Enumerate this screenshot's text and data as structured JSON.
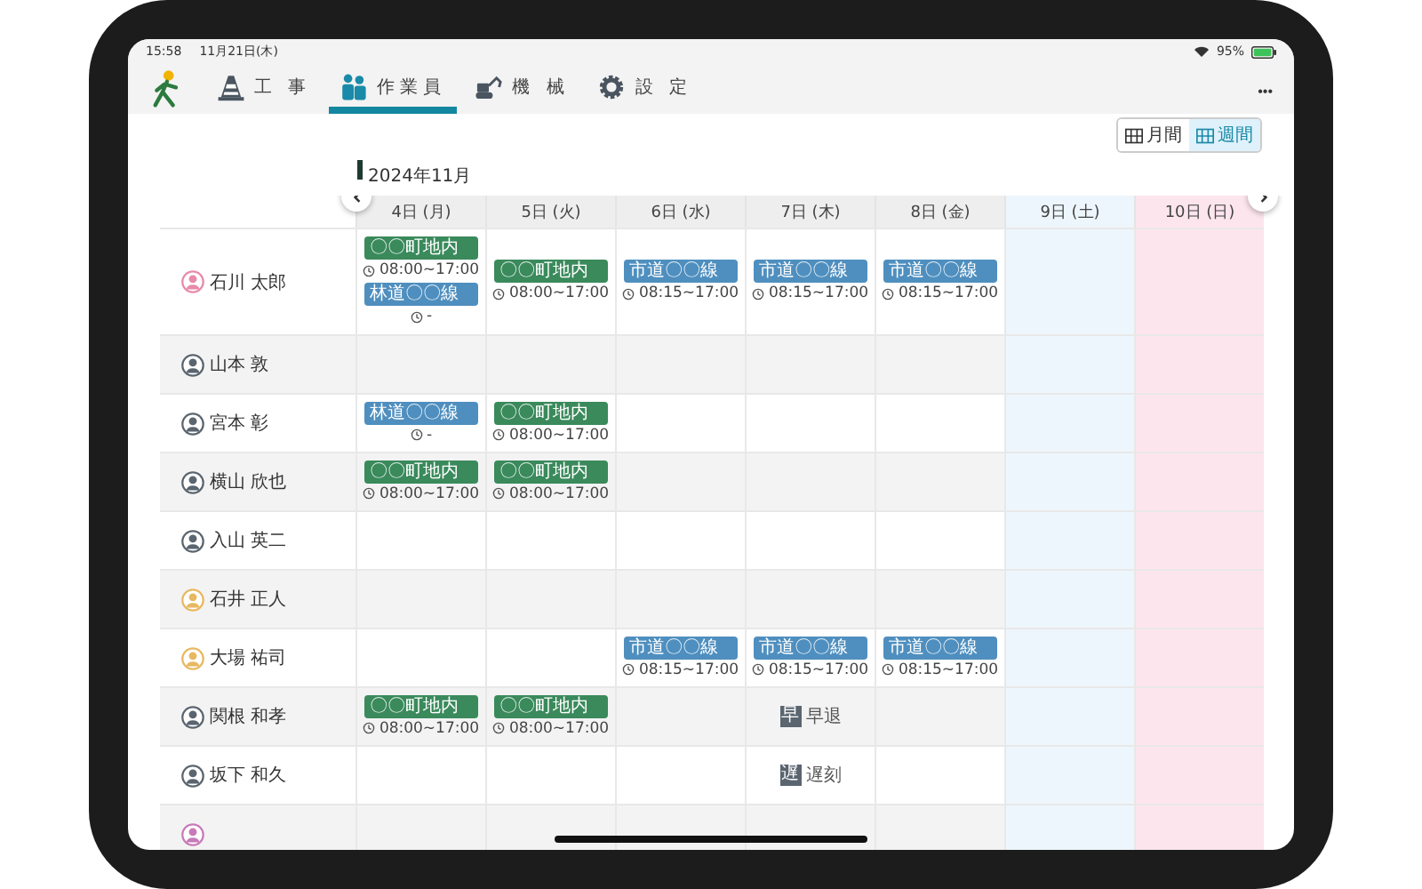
{
  "status_bar": {
    "time": "15:58",
    "date": "11月21日(木)",
    "battery": "95%"
  },
  "nav": {
    "tabs": [
      {
        "label": "工 事",
        "selected": false
      },
      {
        "label": "作業員",
        "selected": true
      },
      {
        "label": "機 械",
        "selected": false
      },
      {
        "label": "設 定",
        "selected": false
      }
    ],
    "menu": "•••"
  },
  "view_toggle": [
    {
      "label": "月間",
      "selected": false
    },
    {
      "label": "週間",
      "selected": true
    }
  ],
  "month": "2024年11月",
  "columns": [
    {
      "label": "4日 (月)",
      "kind": "weekday"
    },
    {
      "label": "5日 (火)",
      "kind": "weekday"
    },
    {
      "label": "6日 (水)",
      "kind": "weekday"
    },
    {
      "label": "7日 (木)",
      "kind": "weekday"
    },
    {
      "label": "8日 (金)",
      "kind": "weekday"
    },
    {
      "label": "9日 (土)",
      "kind": "saturday"
    },
    {
      "label": "10日 (日)",
      "kind": "sunday"
    }
  ],
  "rows": [
    {
      "name": "石川 太郎",
      "color": "#e88aa8",
      "mon": [
        {
          "kind": "site",
          "label": "〇〇町地内",
          "time": "08:00~17:00"
        },
        {
          "kind": "road",
          "label": "林道〇〇線",
          "time": "-"
        }
      ],
      "tue": [
        {
          "kind": "site",
          "label": "〇〇町地内",
          "time": "08:00~17:00"
        }
      ],
      "wed": [
        {
          "kind": "road",
          "label": "市道〇〇線",
          "time": "08:15~17:00"
        }
      ],
      "thu": [
        {
          "kind": "road",
          "label": "市道〇〇線",
          "time": "08:15~17:00"
        }
      ],
      "fri": [
        {
          "kind": "road",
          "label": "市道〇〇線",
          "time": "08:15~17:00"
        }
      ]
    },
    {
      "name": "山本 敦",
      "color": "#5a6570"
    },
    {
      "name": "宮本 彰",
      "color": "#5a6570",
      "mon": [
        {
          "kind": "road",
          "label": "林道〇〇線",
          "time": "-"
        }
      ],
      "tue": [
        {
          "kind": "site",
          "label": "〇〇町地内",
          "time": "08:00~17:00"
        }
      ]
    },
    {
      "name": "横山 欣也",
      "color": "#5a6570",
      "mon": [
        {
          "kind": "site",
          "label": "〇〇町地内",
          "time": "08:00~17:00"
        }
      ],
      "tue": [
        {
          "kind": "site",
          "label": "〇〇町地内",
          "time": "08:00~17:00"
        }
      ]
    },
    {
      "name": "入山 英二",
      "color": "#5a6570"
    },
    {
      "name": "石井 正人",
      "color": "#e8b860"
    },
    {
      "name": "大場 祐司",
      "color": "#e8b860",
      "wed": [
        {
          "kind": "road",
          "label": "市道〇〇線",
          "time": "08:15~17:00"
        }
      ],
      "thu": [
        {
          "kind": "road",
          "label": "市道〇〇線",
          "time": "08:15~17:00"
        }
      ],
      "fri": [
        {
          "kind": "road",
          "label": "市道〇〇線",
          "time": "08:15~17:00"
        }
      ]
    },
    {
      "name": "関根 和孝",
      "color": "#5a6570",
      "mon": [
        {
          "kind": "site",
          "label": "〇〇町地内",
          "time": "08:00~17:00"
        }
      ],
      "tue": [
        {
          "kind": "site",
          "label": "〇〇町地内",
          "time": "08:00~17:00"
        }
      ],
      "thu": [
        {
          "kind": "mark",
          "icon_char": "早",
          "label": "早退"
        }
      ]
    },
    {
      "name": "坂下 和久",
      "color": "#5a6570",
      "thu": [
        {
          "kind": "mark",
          "icon_char": "遅",
          "label": "遅刻"
        }
      ]
    },
    {
      "color": "#c87ab8"
    }
  ]
}
